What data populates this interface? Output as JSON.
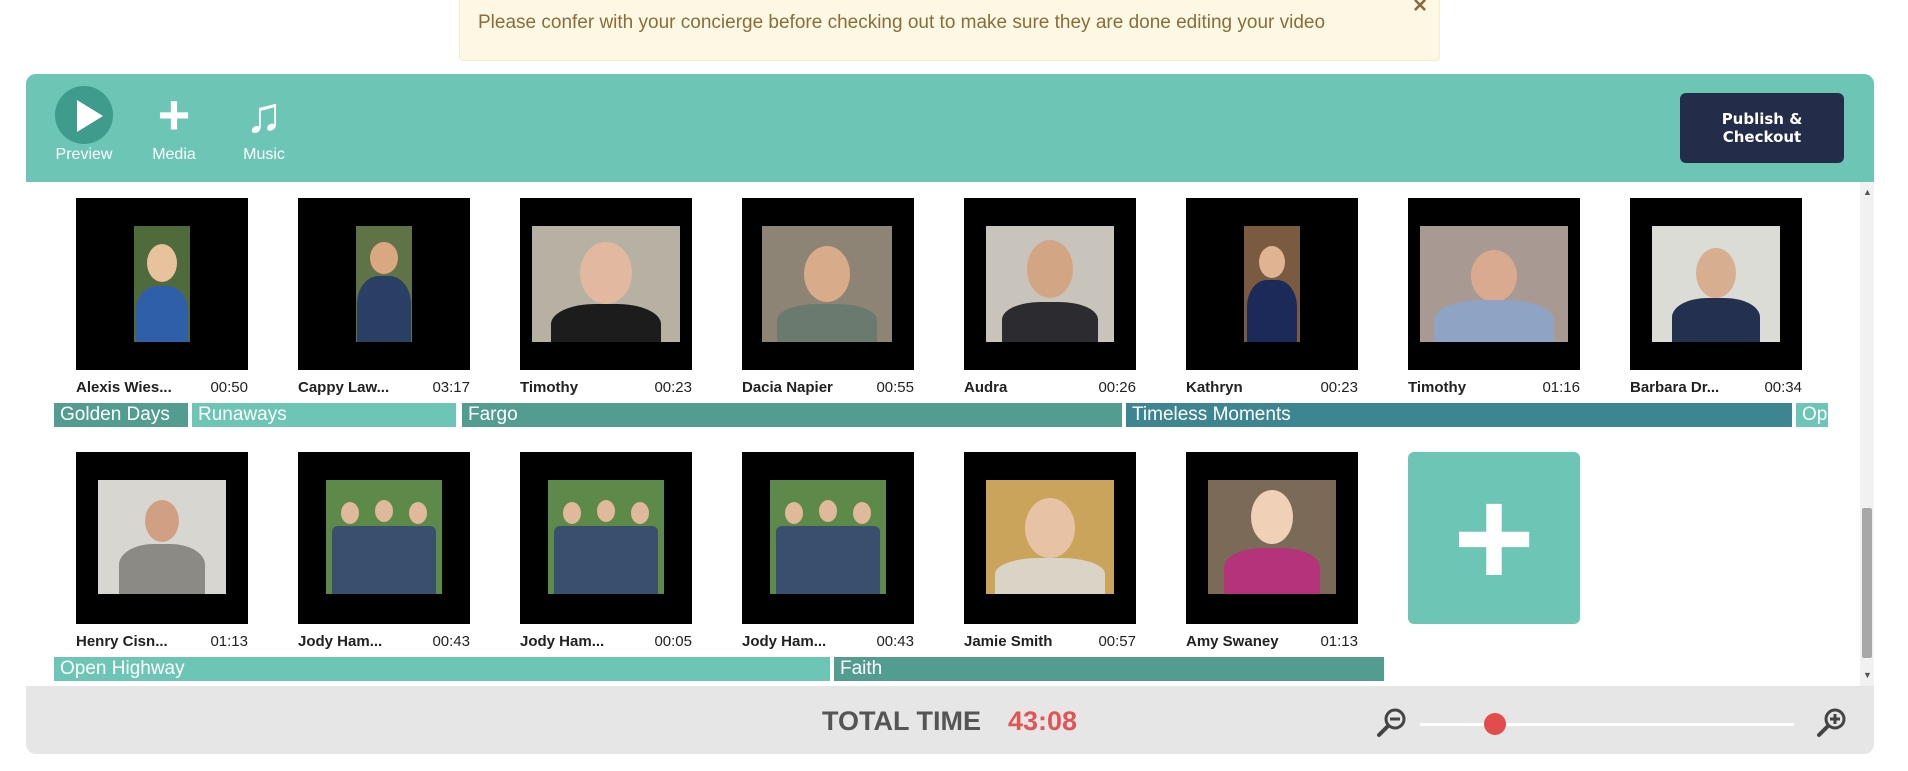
{
  "alert": {
    "message": "Please confer with your concierge before checking out to make sure they are done editing your video",
    "close_glyph": "×"
  },
  "toolbar": {
    "preview_label": "Preview",
    "media_label": "Media",
    "music_label": "Music",
    "media_glyph": "+",
    "music_glyph": "♫",
    "publish_label": "Publish & Checkout"
  },
  "clips_row1": [
    {
      "name": "Alexis Wies...",
      "duration": "00:50"
    },
    {
      "name": "Cappy Law...",
      "duration": "03:17"
    },
    {
      "name": "Timothy",
      "duration": "00:23"
    },
    {
      "name": "Dacia Napier",
      "duration": "00:55"
    },
    {
      "name": "Audra",
      "duration": "00:26"
    },
    {
      "name": "Kathryn",
      "duration": "00:23"
    },
    {
      "name": "Timothy",
      "duration": "01:16"
    },
    {
      "name": "Barbara Dr...",
      "duration": "00:34"
    }
  ],
  "clips_row2": [
    {
      "name": "Henry Cisn...",
      "duration": "01:13"
    },
    {
      "name": "Jody Ham...",
      "duration": "00:43"
    },
    {
      "name": "Jody Ham...",
      "duration": "00:05"
    },
    {
      "name": "Jody Ham...",
      "duration": "00:43"
    },
    {
      "name": "Jamie Smith",
      "duration": "00:57"
    },
    {
      "name": "Amy Swaney",
      "duration": "01:13"
    }
  ],
  "music_row1": [
    {
      "title": "Golden Days"
    },
    {
      "title": "Runaways"
    },
    {
      "title": "Fargo"
    },
    {
      "title": "Timeless Moments"
    },
    {
      "title": "Op"
    }
  ],
  "music_row2": [
    {
      "title": "Open Highway"
    },
    {
      "title": "Faith"
    }
  ],
  "add_glyph": "+",
  "footer": {
    "total_label": "TOTAL TIME",
    "total_value": "43:08",
    "zoom": 0.2
  },
  "colors": {
    "teal": "#6cc5b5",
    "dark_teal": "#529d8f",
    "blue_teal": "#3d8591",
    "publish_bg": "#232c48",
    "accent_red": "#e05656"
  }
}
